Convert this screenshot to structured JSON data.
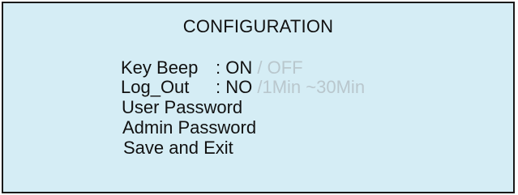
{
  "screen": {
    "title": "CONFIGURATION"
  },
  "menu": {
    "key_beep": {
      "label": "Key Beep",
      "separator": ":",
      "selected": "ON",
      "alternatives": "/ OFF"
    },
    "log_out": {
      "label": "Log_Out",
      "separator": ":",
      "selected": "NO",
      "alternatives": "/1Min ~30Min"
    },
    "user_password": {
      "label": "User Password"
    },
    "admin_password": {
      "label": "Admin Password"
    },
    "save_exit": {
      "label": "Save and Exit"
    }
  },
  "colors": {
    "panel_background": "#d5edf5",
    "border": "#1a1a1a",
    "text": "#111111",
    "inactive_text": "#b9c7cd"
  }
}
